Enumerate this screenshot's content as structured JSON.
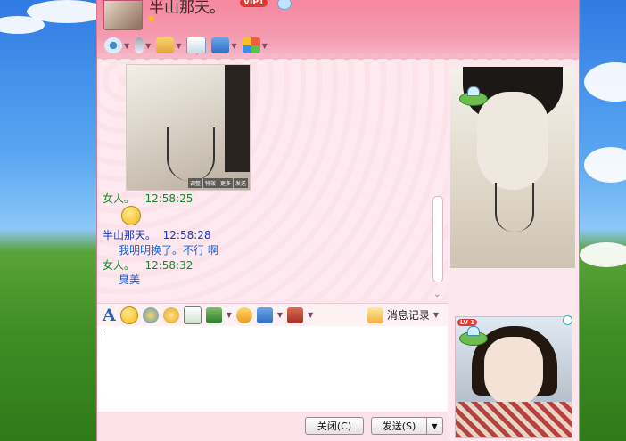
{
  "window": {
    "nickname": "半山那天。",
    "vip_label": "VIP1",
    "level_badge": "LV 1"
  },
  "toolbar": {
    "items": [
      "video-icon",
      "mic-icon",
      "file-transfer-icon",
      "sms-icon",
      "screen-share-icon",
      "apps-icon"
    ]
  },
  "chat": {
    "image_buttons": [
      "调整",
      "特效",
      "更多",
      "发送"
    ],
    "messages": [
      {
        "sender": "女人。",
        "time": "12:58:25",
        "text": "",
        "has_emoji": true
      },
      {
        "sender": "半山那天。",
        "time": "12:58:28",
        "text": "我明明换了。不行 啊"
      },
      {
        "sender": "女人。",
        "time": "12:58:32",
        "text": "臭美"
      }
    ]
  },
  "input_toolbar": {
    "font_glyph": "A",
    "history_label": "消息记录"
  },
  "buttons": {
    "close": "关闭(C)",
    "send": "发送(S)"
  },
  "colors": {
    "header": "#f7889f",
    "background": "#fde7ee",
    "sender_other": "#138a2a",
    "sender_self": "#1a36c0",
    "message_text": "#1560d6"
  }
}
